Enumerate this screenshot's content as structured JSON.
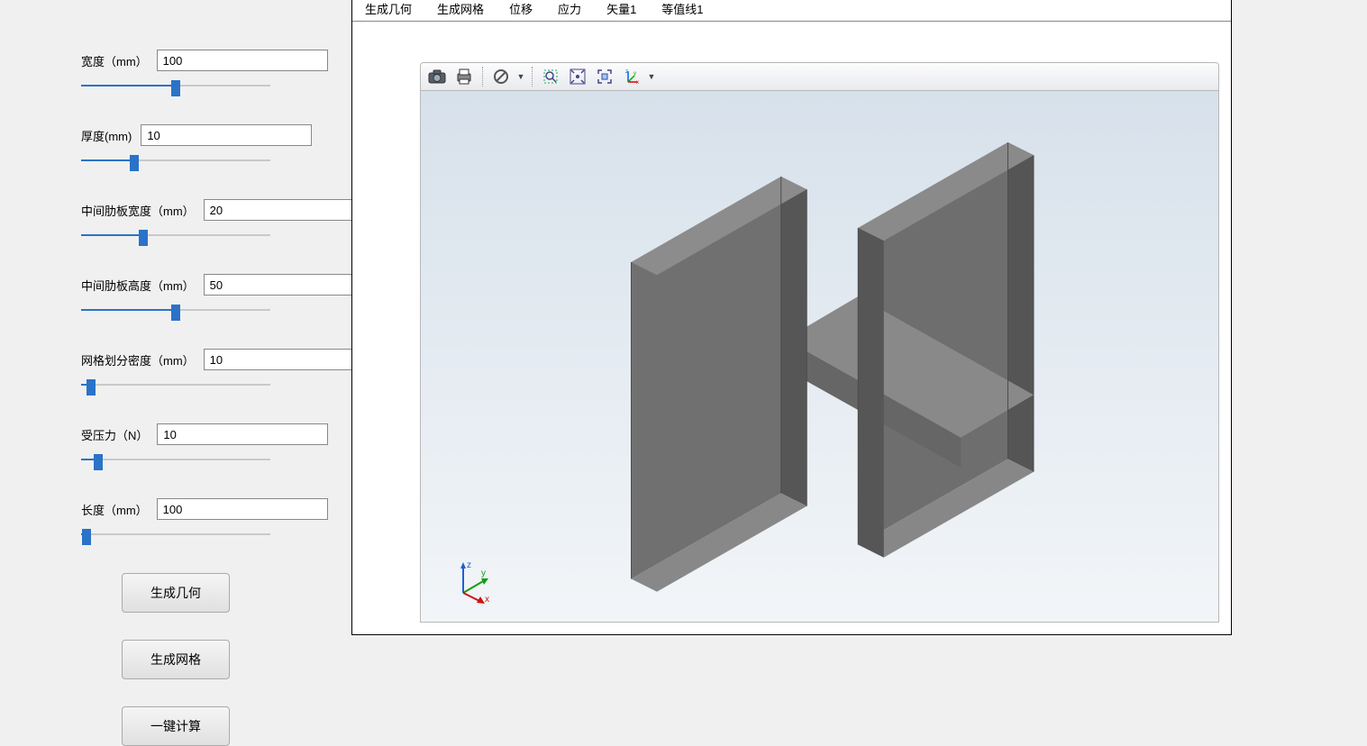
{
  "params": [
    {
      "label": "宽度（mm）",
      "value": "100",
      "pos": 50
    },
    {
      "label": "厚度(mm)",
      "value": "10",
      "pos": 28
    },
    {
      "label": "中间肋板宽度（mm）",
      "value": "20",
      "pos": 33
    },
    {
      "label": "中间肋板高度（mm）",
      "value": "50",
      "pos": 50
    },
    {
      "label": "网格划分密度（mm）",
      "value": "10",
      "pos": 5
    },
    {
      "label": "受压力（N）",
      "value": "10",
      "pos": 9
    },
    {
      "label": "长度（mm）",
      "value": "100",
      "pos": 3
    }
  ],
  "buttons": {
    "gen_geometry": "生成几何",
    "gen_mesh": "生成网格",
    "calc_all": "一键计算"
  },
  "tabs": [
    {
      "label": "生成几何",
      "active": true
    },
    {
      "label": "生成网格"
    },
    {
      "label": "位移"
    },
    {
      "label": "应力"
    },
    {
      "label": "矢量1"
    },
    {
      "label": "等值线1"
    }
  ],
  "toolbar_icons": [
    "camera-icon",
    "print-icon",
    "sep",
    "deny-icon",
    "dd",
    "sep",
    "zoom-box-icon",
    "zoom-extent-icon",
    "zoom-selection-icon",
    "axes-icon",
    "dd"
  ],
  "axes_labels": {
    "x": "x",
    "y": "y",
    "z": "z"
  }
}
